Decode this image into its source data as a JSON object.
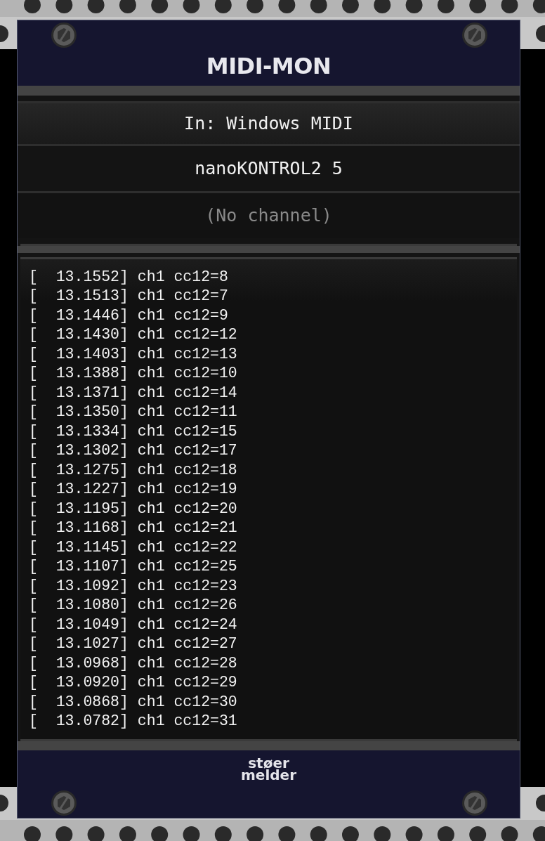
{
  "module": {
    "title": "MIDI-MON"
  },
  "selectors": [
    {
      "label": "In: Windows MIDI",
      "kind": "driver",
      "unset": false
    },
    {
      "label": "nanoKONTROL2 5",
      "kind": "device",
      "unset": false
    },
    {
      "label": "(No channel)",
      "kind": "channel",
      "unset": true
    }
  ],
  "log": [
    "[  13.1552] ch1 cc12=8",
    "[  13.1513] ch1 cc12=7",
    "[  13.1446] ch1 cc12=9",
    "[  13.1430] ch1 cc12=12",
    "[  13.1403] ch1 cc12=13",
    "[  13.1388] ch1 cc12=10",
    "[  13.1371] ch1 cc12=14",
    "[  13.1350] ch1 cc12=11",
    "[  13.1334] ch1 cc12=15",
    "[  13.1302] ch1 cc12=17",
    "[  13.1275] ch1 cc12=18",
    "[  13.1227] ch1 cc12=19",
    "[  13.1195] ch1 cc12=20",
    "[  13.1168] ch1 cc12=21",
    "[  13.1145] ch1 cc12=22",
    "[  13.1107] ch1 cc12=25",
    "[  13.1092] ch1 cc12=23",
    "[  13.1080] ch1 cc12=26",
    "[  13.1049] ch1 cc12=24",
    "[  13.1027] ch1 cc12=27",
    "[  13.0968] ch1 cc12=28",
    "[  13.0920] ch1 cc12=29",
    "[  13.0868] ch1 cc12=30",
    "[  13.0782] ch1 cc12=31"
  ],
  "brand": [
    "støer",
    "melder"
  ]
}
